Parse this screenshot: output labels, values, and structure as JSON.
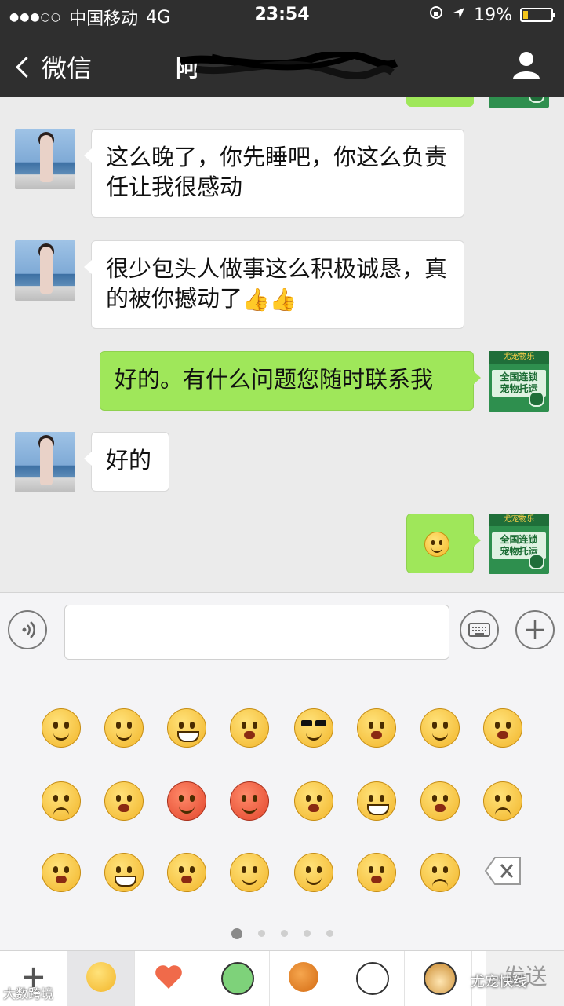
{
  "status_bar": {
    "signal_dots": "●●●○○",
    "carrier": "中国移动",
    "network": "4G",
    "time": "23:54",
    "battery_percent": "19%",
    "battery_level": 0.19
  },
  "nav": {
    "back_label": "微信",
    "contact_name_prefix": "阿"
  },
  "messages": [
    {
      "side": "left",
      "text": "这么晚了，你先睡吧，你这么负责任让我很感动"
    },
    {
      "side": "left",
      "text": "很少包头人做事这么积极诚恳，真的被你撼动了",
      "trailing": "👍👍"
    },
    {
      "side": "right",
      "text": "好的。有什么问题您随时联系我"
    },
    {
      "side": "left",
      "text": "好的"
    },
    {
      "side": "right",
      "text": "",
      "emoji": "smile-emoji"
    }
  ],
  "avatar_shop": {
    "brand": "尤宠物乐",
    "slogan_line1": "全国连锁",
    "slogan_line2": "宠物托运"
  },
  "input": {
    "voice_icon": "voice-icon",
    "keyboard_icon": "keyboard-icon",
    "plus_icon": "plus-icon",
    "value": ""
  },
  "emoji_panel": {
    "pages": 5,
    "active_page": 1
  },
  "tabs": {
    "send_label": "发送",
    "plus_label": "+"
  },
  "watermarks": {
    "left": "大数跨境",
    "right": "尤宠快线"
  },
  "colors": {
    "navbar": "#2f2f2f",
    "my_bubble": "#9fe75a",
    "their_bubble": "#ffffff",
    "background": "#ebebeb"
  }
}
